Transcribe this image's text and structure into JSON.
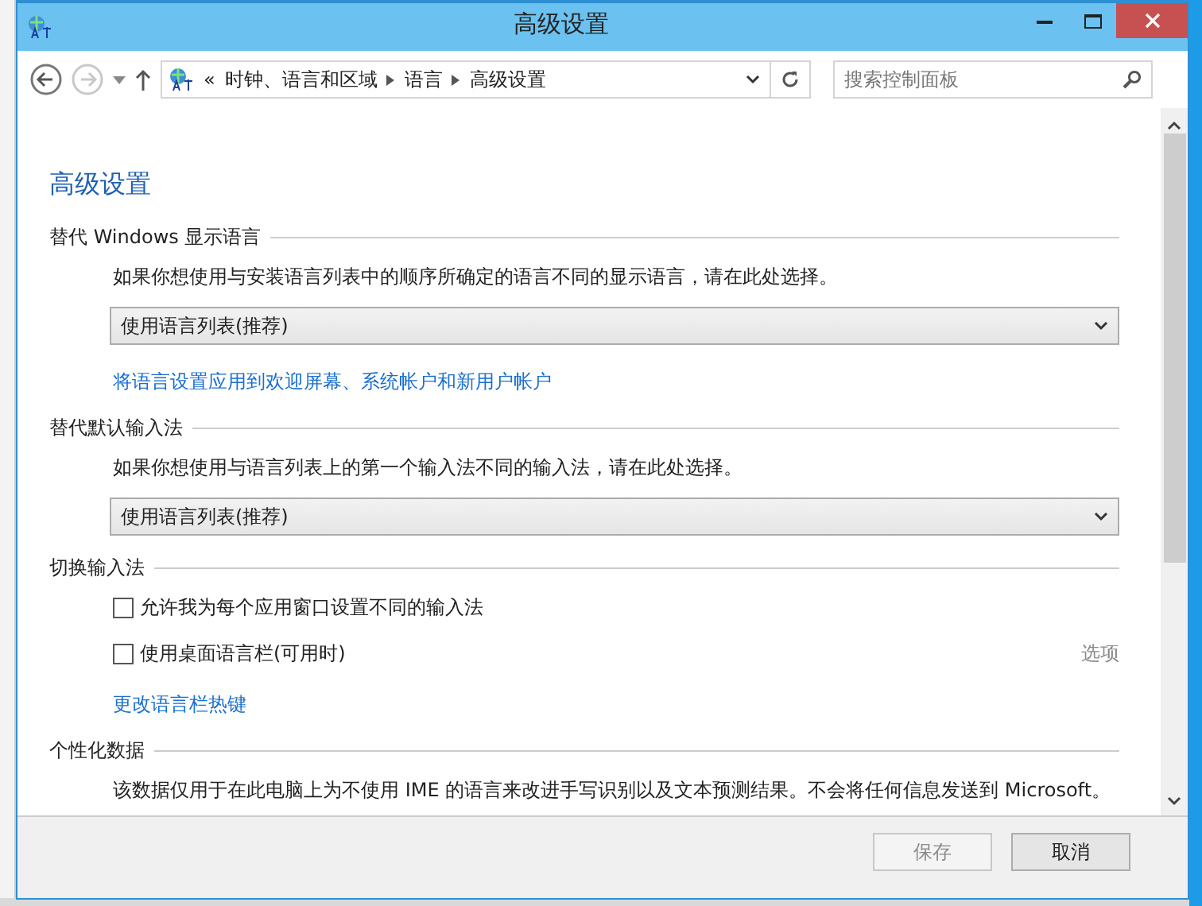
{
  "window": {
    "title": "高级设置"
  },
  "address_bar": {
    "overflow": "«",
    "crumbs": [
      "时钟、语言和区域",
      "语言",
      "高级设置"
    ]
  },
  "search": {
    "placeholder": "搜索控制面板"
  },
  "nav": {
    "back_disabled": false,
    "forward_disabled": true
  },
  "page_title": "高级设置",
  "sections": [
    {
      "heading": "替代 Windows 显示语言",
      "items": [
        {
          "kind": "text",
          "text": "如果你想使用与安装语言列表中的顺序所确定的语言不同的显示语言，请在此处选择。"
        },
        {
          "kind": "dropdown",
          "value": "使用语言列表(推荐)"
        },
        {
          "kind": "link",
          "text": "将语言设置应用到欢迎屏幕、系统帐户和新用户帐户"
        }
      ]
    },
    {
      "heading": "替代默认输入法",
      "items": [
        {
          "kind": "text",
          "text": "如果你想使用与语言列表上的第一个输入法不同的输入法，请在此处选择。"
        },
        {
          "kind": "dropdown",
          "value": "使用语言列表(推荐)"
        }
      ]
    },
    {
      "heading": "切换输入法",
      "items": [
        {
          "kind": "checkbox",
          "label": "允许我为每个应用窗口设置不同的输入法",
          "checked": false
        },
        {
          "kind": "checkbox",
          "label": "使用桌面语言栏(可用时)",
          "checked": false,
          "option_link": "选项",
          "option_disabled": true
        },
        {
          "kind": "link",
          "text": "更改语言栏热键"
        }
      ]
    },
    {
      "heading": "个性化数据",
      "items": [
        {
          "kind": "text",
          "text": "该数据仅用于在此电脑上为不使用 IME 的语言来改进手写识别以及文本预测结果。不会将任何信息发送到 Microsoft。"
        }
      ]
    }
  ],
  "buttons": [
    {
      "label": "保存",
      "disabled": true
    },
    {
      "label": "取消",
      "disabled": false
    }
  ]
}
